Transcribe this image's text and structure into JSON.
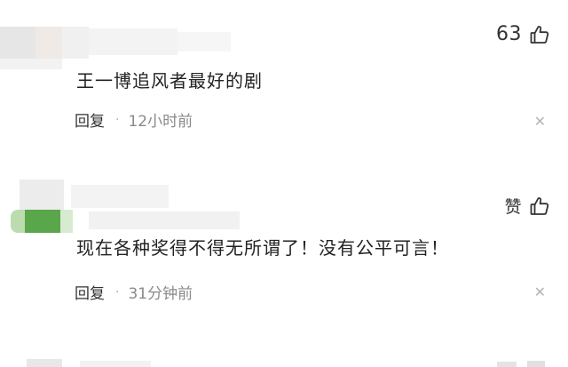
{
  "comments": [
    {
      "like_count": "63",
      "text": "王一博追风者最好的剧",
      "reply_label": "回复",
      "separator": "·",
      "time": "12小时前"
    },
    {
      "like_label": "赞",
      "text": "现在各种奖得不得无所谓了！没有公平可言！",
      "reply_label": "回复",
      "separator": "·",
      "time": "31分钟前"
    }
  ],
  "icons": {
    "like": "thumbs-up-icon",
    "close": "close-icon"
  },
  "colors": {
    "text": "#222222",
    "meta": "#8a8a8a",
    "close": "#b5b5b5"
  }
}
